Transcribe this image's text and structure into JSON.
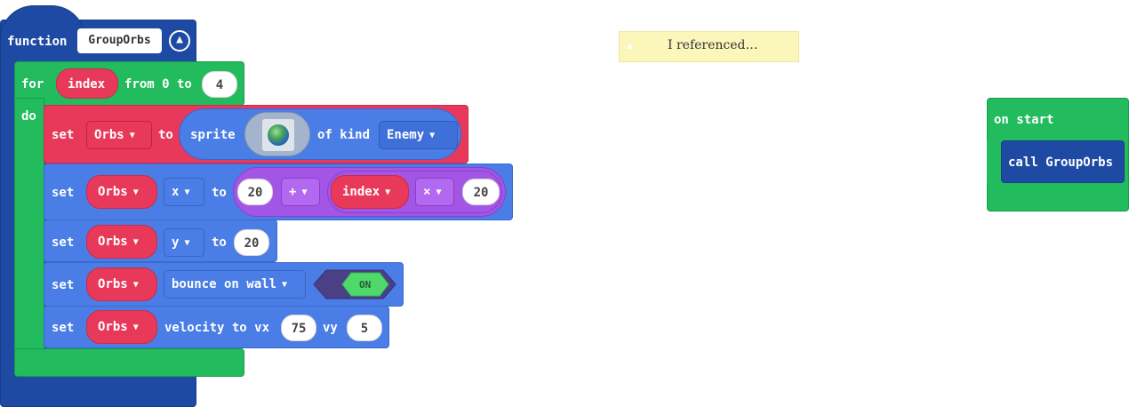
{
  "function_block": {
    "keyword": "function",
    "name": "GroupOrbs",
    "collapse_icon": "chevron-up-icon"
  },
  "for_loop": {
    "keyword": "for",
    "variable": "index",
    "from_label": "from 0 to",
    "end_value": "4",
    "do_label": "do"
  },
  "statements": {
    "sprite_set": {
      "set_label": "set",
      "variable": "Orbs",
      "to_label": "to",
      "sprite_label": "sprite",
      "of_kind_label": "of kind",
      "kind": "Enemy"
    },
    "x_set": {
      "set_label": "set",
      "variable": "Orbs",
      "property": "x",
      "to_label": "to",
      "first_operand": "20",
      "operator": "+",
      "index_var": "index",
      "multiply_operator": "×",
      "second_operand": "20"
    },
    "y_set": {
      "set_label": "set",
      "variable": "Orbs",
      "property": "y",
      "to_label": "to",
      "value": "20"
    },
    "bounce_set": {
      "set_label": "set",
      "variable": "Orbs",
      "flag": "bounce on wall",
      "toggle_label": "ON"
    },
    "velocity_set": {
      "set_label": "set",
      "variable": "Orbs",
      "velocity_label": "velocity to vx",
      "vx": "75",
      "vy_label": "vy",
      "vy": "5"
    }
  },
  "comment": {
    "text": "I referenced…"
  },
  "on_start": {
    "label": "on start",
    "call_label": "call GroupOrbs"
  },
  "colors": {
    "functions": "#1e4aa3",
    "loops": "#22bb5d",
    "sprites": "#e8395b",
    "physics": "#4a7de5",
    "math": "#a356e6",
    "toggle_on": "#4fd96b",
    "comment_bg": "#fbf6ba"
  }
}
